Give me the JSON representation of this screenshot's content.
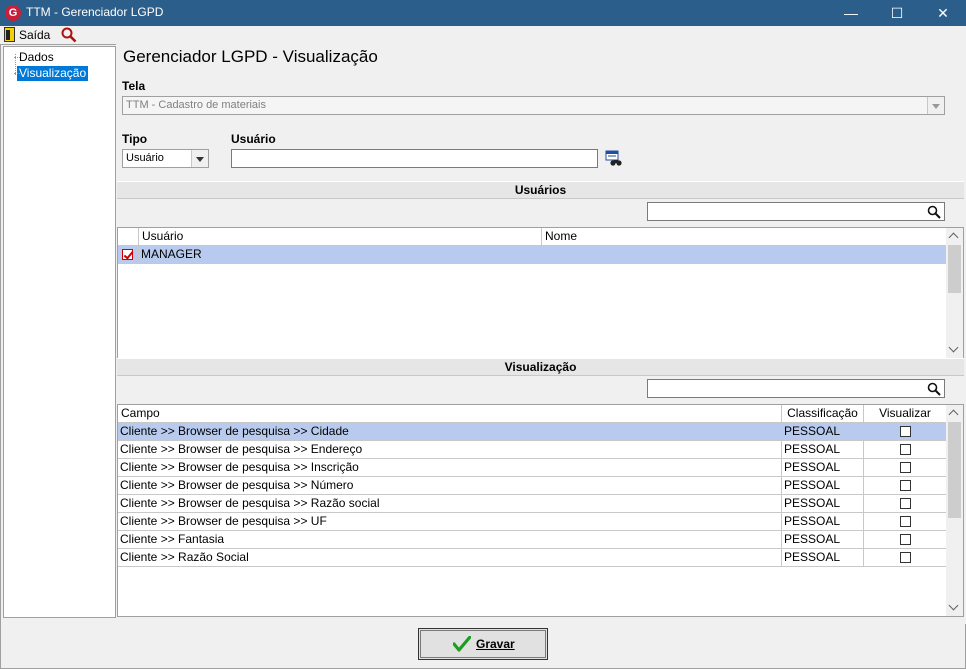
{
  "window": {
    "title": "TTM - Gerenciador LGPD",
    "app_icon": "G"
  },
  "titlebar_buttons": {
    "minimize": "—",
    "maximize": "☐",
    "close": "✕"
  },
  "toolbar": {
    "exit_label": "Saída"
  },
  "tree": {
    "items": [
      {
        "label": "Dados"
      },
      {
        "label": "Visualização"
      }
    ]
  },
  "page": {
    "title": "Gerenciador LGPD - Visualização"
  },
  "tela": {
    "label": "Tela",
    "value": "TTM - Cadastro de materiais"
  },
  "tipo": {
    "label": "Tipo",
    "value": "Usuário"
  },
  "usuario": {
    "label": "Usuário",
    "value": ""
  },
  "usuarios_section": {
    "header": "Usuários",
    "columns": [
      "Usuário",
      "Nome"
    ],
    "rows": [
      {
        "checked": true,
        "usuario": "MANAGER",
        "nome": ""
      }
    ]
  },
  "visualizacao_section": {
    "header": "Visualização",
    "columns": [
      "Campo",
      "Classificação",
      "Visualizar"
    ],
    "rows": [
      {
        "campo": "Cliente >> Browser de pesquisa >> Cidade",
        "classificacao": "PESSOAL",
        "visualizar": false
      },
      {
        "campo": "Cliente >> Browser de pesquisa >> Endereço",
        "classificacao": "PESSOAL",
        "visualizar": false
      },
      {
        "campo": "Cliente >> Browser de pesquisa >> Inscrição",
        "classificacao": "PESSOAL",
        "visualizar": false
      },
      {
        "campo": "Cliente >> Browser de pesquisa >> Número",
        "classificacao": "PESSOAL",
        "visualizar": false
      },
      {
        "campo": "Cliente >> Browser de pesquisa >> Razão social",
        "classificacao": "PESSOAL",
        "visualizar": false
      },
      {
        "campo": "Cliente >> Browser de pesquisa >> UF",
        "classificacao": "PESSOAL",
        "visualizar": false
      },
      {
        "campo": "Cliente >> Fantasia",
        "classificacao": "PESSOAL",
        "visualizar": false
      },
      {
        "campo": "Cliente >> Razão Social",
        "classificacao": "PESSOAL",
        "visualizar": false
      }
    ]
  },
  "footer": {
    "save_label": "Gravar"
  },
  "colors": {
    "titlebar": "#2b5e8a",
    "selection": "#b8cbee",
    "tree_selection": "#0078d7",
    "check_accent": "#cc0000",
    "save_icon": "#1e9e1e"
  },
  "icons": [
    "app-logo-icon",
    "exit-door-icon",
    "search-icon",
    "binoculars-icon",
    "checkmark-icon"
  ]
}
